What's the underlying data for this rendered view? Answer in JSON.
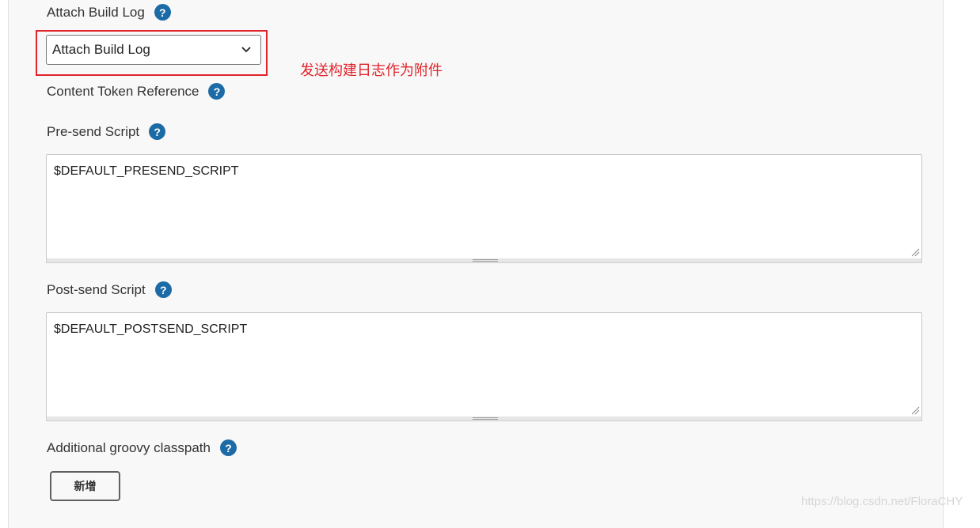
{
  "attach_build_log": {
    "label": "Attach Build Log",
    "help_icon": "?",
    "selected_value": "Attach Build Log",
    "annotation": "发送构建日志作为附件"
  },
  "content_token": {
    "label": "Content Token Reference",
    "help_icon": "?"
  },
  "presend_script": {
    "label": "Pre-send Script",
    "help_icon": "?",
    "value": "$DEFAULT_PRESEND_SCRIPT"
  },
  "postsend_script": {
    "label": "Post-send Script",
    "help_icon": "?",
    "value": "$DEFAULT_POSTSEND_SCRIPT"
  },
  "groovy_classpath": {
    "label": "Additional groovy classpath",
    "help_icon": "?",
    "add_button_label": "新增"
  },
  "watermark": "https://blog.csdn.net/FloraCHY",
  "colors": {
    "help_icon": "#1d6ba6",
    "annotation": "#e0242b",
    "highlight_border": "#e0242b"
  }
}
